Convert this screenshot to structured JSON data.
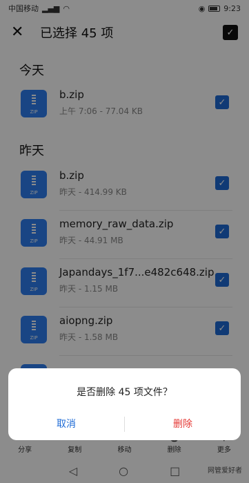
{
  "status": {
    "carrier": "中国移动",
    "time": "9:23"
  },
  "header": {
    "title": "已选择 45 项"
  },
  "sections": {
    "today": "今天",
    "yesterday": "昨天"
  },
  "icon_label": "ZIP",
  "files": [
    {
      "name": "b.zip",
      "meta": "上午 7:06 - 77.04 KB"
    },
    {
      "name": "b.zip",
      "meta": "昨天 - 414.99 KB"
    },
    {
      "name": "memory_raw_data.zip",
      "meta": "昨天 - 44.91 MB"
    },
    {
      "name": "Japandays_1f7...e482c648.zip",
      "meta": "昨天 - 1.15 MB"
    },
    {
      "name": "aiopng.zip",
      "meta": "昨天 - 1.58 MB"
    }
  ],
  "bottom_bar": [
    "分享",
    "复制",
    "移动",
    "删除",
    "更多"
  ],
  "dialog": {
    "message": "是否删除 45 项文件？",
    "cancel": "取消",
    "delete": "删除"
  },
  "watermark": "网管爱好者",
  "colors": {
    "accent": "#1e6bd6",
    "danger": "#e53935",
    "icon": "#2f7ff0"
  }
}
